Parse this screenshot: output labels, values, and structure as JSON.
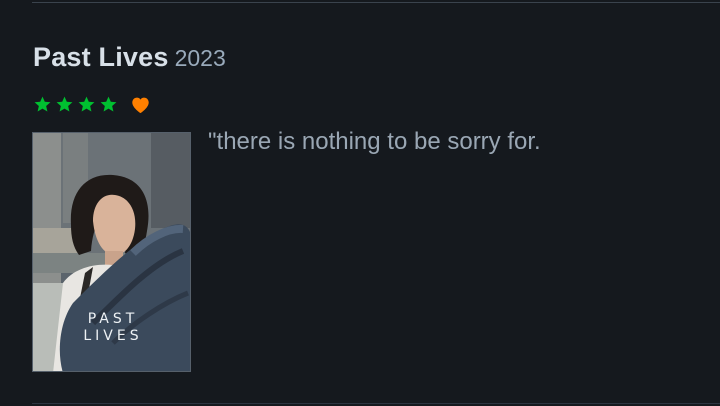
{
  "film": {
    "title": "Past Lives",
    "year": "2023",
    "poster_title_line1": "PAST",
    "poster_title_line2": "LIVES"
  },
  "review": {
    "stars": 4,
    "liked": true,
    "text": "\"there is nothing to be sorry for."
  },
  "colors": {
    "background": "#15191e",
    "star": "#00c030",
    "heart": "#ff8000",
    "title": "#d8e0e8",
    "body_text": "#9aa7b4"
  },
  "icons": {
    "star": "star-icon",
    "heart": "heart-icon"
  }
}
